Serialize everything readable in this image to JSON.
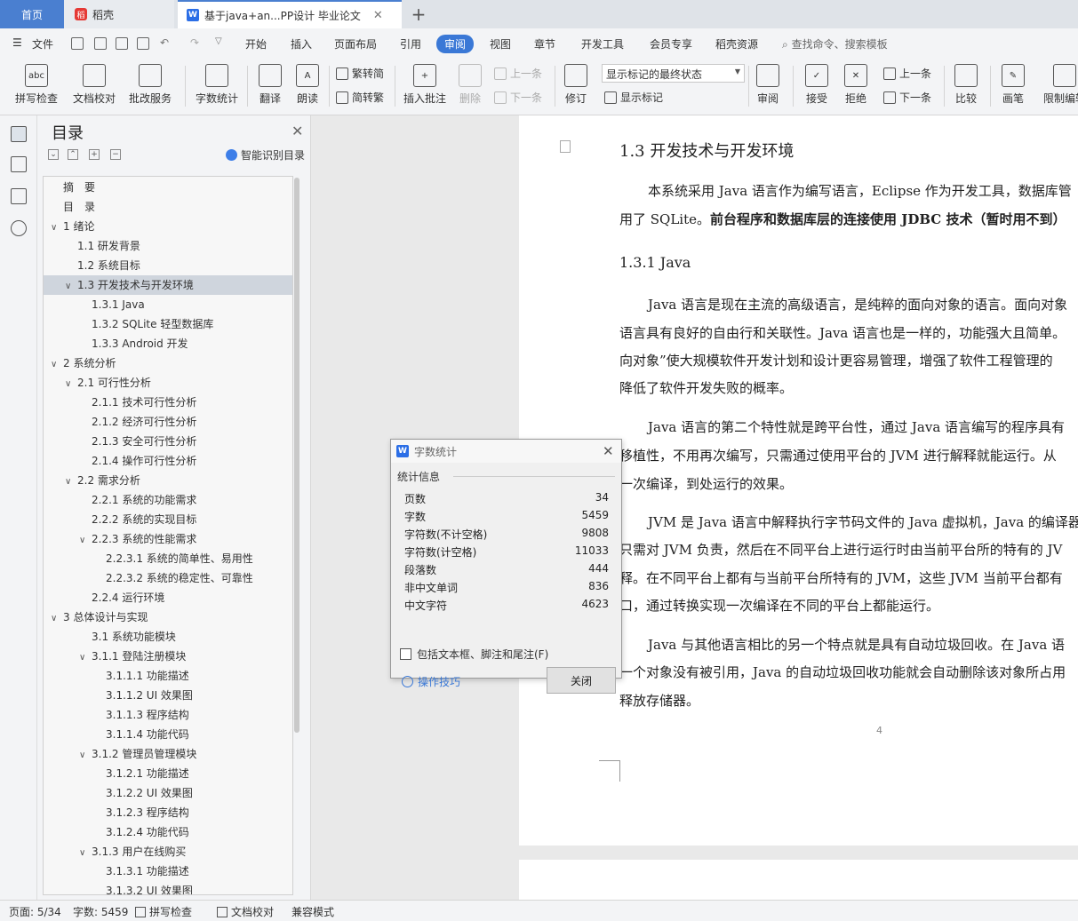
{
  "tabs": {
    "home": "首页",
    "daoke": "稻壳",
    "doc": "基于java+an...PP设计 毕业论文",
    "plus": "+"
  },
  "menubar": {
    "file": "文件",
    "items": [
      "开始",
      "插入",
      "页面布局",
      "引用",
      "审阅",
      "视图",
      "章节",
      "开发工具",
      "会员专享",
      "稻壳资源"
    ],
    "active_index": 4,
    "search": "查找命令、搜索模板"
  },
  "ribbon": {
    "spell": "拼写检查",
    "doc_check": "文档校对",
    "approve": "批改服务",
    "word_count": "字数统计",
    "translate": "翻译",
    "read": "朗读",
    "trad": "繁转简",
    "simp": "简转繁",
    "insert_comment": "插入批注",
    "delete": "删除",
    "prev": "上一条",
    "next": "下一条",
    "revise": "修订",
    "markup_state": "显示标记的最终状态",
    "show_marks": "显示标记",
    "review": "审阅",
    "accept": "接受",
    "reject": "拒绝",
    "prev2": "上一条",
    "next2": "下一条",
    "compare": "比较",
    "pen": "画笔",
    "restrict": "限制编辑"
  },
  "toc": {
    "title": "目录",
    "smart": "智能识别目录",
    "items": [
      {
        "text": "摘　要",
        "level": 0,
        "arrow": ""
      },
      {
        "text": "目　录",
        "level": 0,
        "arrow": ""
      },
      {
        "text": "1  绪论",
        "level": 0,
        "arrow": "v"
      },
      {
        "text": "1.1  研发背景",
        "level": 1,
        "arrow": ""
      },
      {
        "text": "1.2  系统目标",
        "level": 1,
        "arrow": ""
      },
      {
        "text": "1.3  开发技术与开发环境",
        "level": 1,
        "arrow": "v",
        "selected": true
      },
      {
        "text": "1.3.1 Java",
        "level": 2,
        "arrow": ""
      },
      {
        "text": "1.3.2   SQLite  轻型数据库",
        "level": 2,
        "arrow": ""
      },
      {
        "text": "1.3.3    Android 开发",
        "level": 2,
        "arrow": ""
      },
      {
        "text": "2  系统分析",
        "level": 0,
        "arrow": "v"
      },
      {
        "text": "2.1  可行性分析",
        "level": 1,
        "arrow": "v"
      },
      {
        "text": "2.1.1  技术可行性分析",
        "level": 2,
        "arrow": ""
      },
      {
        "text": "2.1.2  经济可行性分析",
        "level": 2,
        "arrow": ""
      },
      {
        "text": "2.1.3  安全可行性分析",
        "level": 2,
        "arrow": ""
      },
      {
        "text": "2.1.4  操作可行性分析",
        "level": 2,
        "arrow": ""
      },
      {
        "text": "2.2  需求分析",
        "level": 1,
        "arrow": "v"
      },
      {
        "text": "2.2.1  系统的功能需求",
        "level": 2,
        "arrow": ""
      },
      {
        "text": "2.2.2  系统的实现目标",
        "level": 2,
        "arrow": ""
      },
      {
        "text": "2.2.3  系统的性能需求",
        "level": 2,
        "arrow": "v"
      },
      {
        "text": "2.2.3.1  系统的简单性、易用性",
        "level": 3,
        "arrow": ""
      },
      {
        "text": "2.2.3.2  系统的稳定性、可靠性",
        "level": 3,
        "arrow": ""
      },
      {
        "text": "2.2.4  运行环境",
        "level": 2,
        "arrow": ""
      },
      {
        "text": "3  总体设计与实现",
        "level": 0,
        "arrow": "v"
      },
      {
        "text": "3.1  系统功能模块",
        "level": 2,
        "arrow": ""
      },
      {
        "text": "3.1.1 登陆注册模块",
        "level": 2,
        "arrow": "v"
      },
      {
        "text": "3.1.1.1  功能描述",
        "level": 3,
        "arrow": ""
      },
      {
        "text": "3.1.1.2 UI 效果图",
        "level": 3,
        "arrow": ""
      },
      {
        "text": "3.1.1.3  程序结构",
        "level": 3,
        "arrow": ""
      },
      {
        "text": "3.1.1.4  功能代码",
        "level": 3,
        "arrow": ""
      },
      {
        "text": "3.1.2 管理员管理模块",
        "level": 2,
        "arrow": "v"
      },
      {
        "text": "3.1.2.1  功能描述",
        "level": 3,
        "arrow": ""
      },
      {
        "text": "3.1.2.2 UI 效果图",
        "level": 3,
        "arrow": ""
      },
      {
        "text": "3.1.2.3  程序结构",
        "level": 3,
        "arrow": ""
      },
      {
        "text": "3.1.2.4  功能代码",
        "level": 3,
        "arrow": ""
      },
      {
        "text": "3.1.3 用户在线购买",
        "level": 2,
        "arrow": "v"
      },
      {
        "text": "3.1.3.1  功能描述",
        "level": 3,
        "arrow": ""
      },
      {
        "text": "3.1.3.2 UI 效果图",
        "level": 3,
        "arrow": ""
      }
    ]
  },
  "document": {
    "heading": "1.3  开发技术与开发环境",
    "p1_l1": "本系统采用 Java 语言作为编写语言，Eclipse 作为开发工具，数据库管",
    "p1_l2a": "用了 SQLite。",
    "p1_l2b": "前台程序和数据库层的连接使用 JDBC 技术（暂时用不到）",
    "subheading": "1.3.1 Java",
    "p2_l1": "Java 语言是现在主流的高级语言，是纯粹的面向对象的语言。面向对象",
    "p2_l2": "语言具有良好的自由行和关联性。Java 语言也是一样的，功能强大且简单。",
    "p2_l3": "向对象”使大规模软件开发计划和设计更容易管理，增强了软件工程管理的",
    "p2_l4": "降低了软件开发失败的概率。",
    "p3_l1": "Java 语言的第二个特性就是跨平台性，通过 Java 语言编写的程序具有",
    "p3_l2": "移植性，不用再次编写，只需通过使用平台的 JVM 进行解释就能运行。从",
    "p3_l3": "一次编译，到处运行的效果。",
    "p4_l1": "JVM 是 Java 语言中解释执行字节码文件的 Java 虚拟机，Java 的编译器",
    "p4_l2": "只需对 JVM 负责，然后在不同平台上进行运行时由当前平台所的特有的 JV",
    "p4_l3": "释。在不同平台上都有与当前平台所特有的 JVM，这些 JVM 当前平台都有",
    "p4_l4": "口，通过转换实现一次编译在不同的平台上都能运行。",
    "p5_l1": "Java 与其他语言相比的另一个特点就是具有自动垃圾回收。在 Java 语",
    "p5_l2": "一个对象没有被引用，Java 的自动垃圾回收功能就会自动删除该对象所占用",
    "p5_l3": "释放存储器。",
    "page_number": "4"
  },
  "dialog": {
    "title": "字数统计",
    "section": "统计信息",
    "rows": [
      {
        "label": "页数",
        "value": "34"
      },
      {
        "label": "字数",
        "value": "5459"
      },
      {
        "label": "字符数(不计空格)",
        "value": "9808"
      },
      {
        "label": "字符数(计空格)",
        "value": "11033"
      },
      {
        "label": "段落数",
        "value": "444"
      },
      {
        "label": "非中文单词",
        "value": "836"
      },
      {
        "label": "中文字符",
        "value": "4623"
      }
    ],
    "checkbox": "包括文本框、脚注和尾注(F)",
    "tips": "操作技巧",
    "close": "关闭"
  },
  "status": {
    "page": "页面: 5/34",
    "words": "字数: 5459",
    "spell": "拼写检查",
    "doc_check": "文档校对",
    "compat": "兼容模式"
  }
}
